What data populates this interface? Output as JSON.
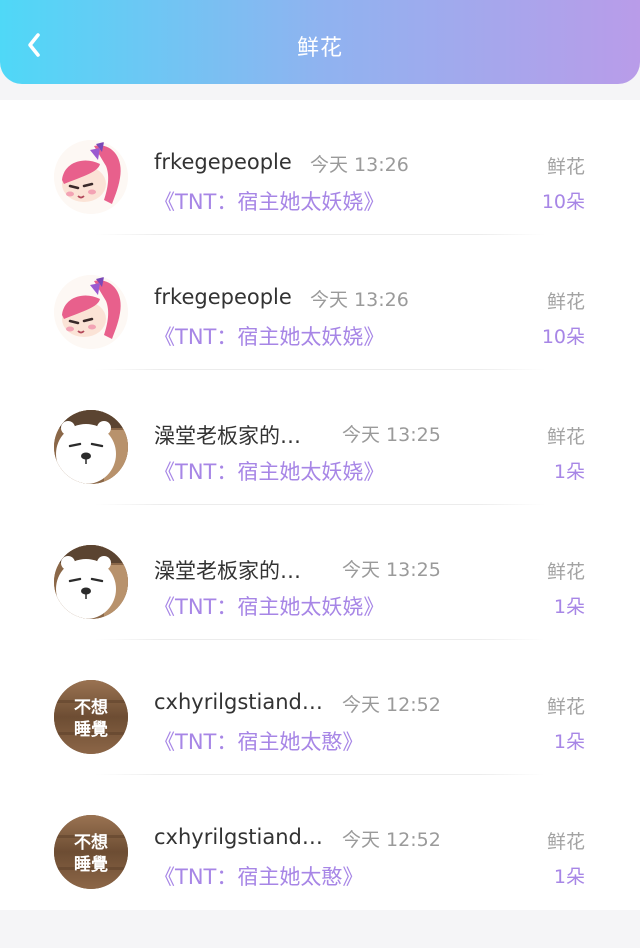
{
  "header": {
    "title": "鲜花",
    "back_icon": "chevron-left-icon",
    "gradient_colors": [
      "#4fd8f7",
      "#b99ce9"
    ]
  },
  "records": [
    {
      "user": "frkegepeople",
      "time": "今天 13:26",
      "book": "《TNT：宿主她太妖娆》",
      "gift": "鲜花",
      "qty": "10朵",
      "avatar": "anime-girl"
    },
    {
      "user": "frkegepeople",
      "time": "今天 13:26",
      "book": "《TNT：宿主她太妖娆》",
      "gift": "鲜花",
      "qty": "10朵",
      "avatar": "anime-girl"
    },
    {
      "user": "澡堂老板家的…",
      "time": "今天 13:25",
      "book": "《TNT：宿主她太妖娆》",
      "gift": "鲜花",
      "qty": "1朵",
      "avatar": "polar-bear"
    },
    {
      "user": "澡堂老板家的…",
      "time": "今天 13:25",
      "book": "《TNT：宿主她太妖娆》",
      "gift": "鲜花",
      "qty": "1朵",
      "avatar": "polar-bear"
    },
    {
      "user": "cxhyrilgstiand…",
      "time": "今天 12:52",
      "book": "《TNT：宿主她太憨》",
      "gift": "鲜花",
      "qty": "1朵",
      "avatar": "text-badge",
      "avatar_text": [
        "不想",
        "睡覺"
      ]
    },
    {
      "user": "cxhyrilgstiand…",
      "time": "今天 12:52",
      "book": "《TNT：宿主她太憨》",
      "gift": "鲜花",
      "qty": "1朵",
      "avatar": "text-badge",
      "avatar_text": [
        "不想",
        "睡覺"
      ]
    }
  ],
  "colors": {
    "accent": "#a786e6",
    "muted": "#9a9a9a"
  }
}
